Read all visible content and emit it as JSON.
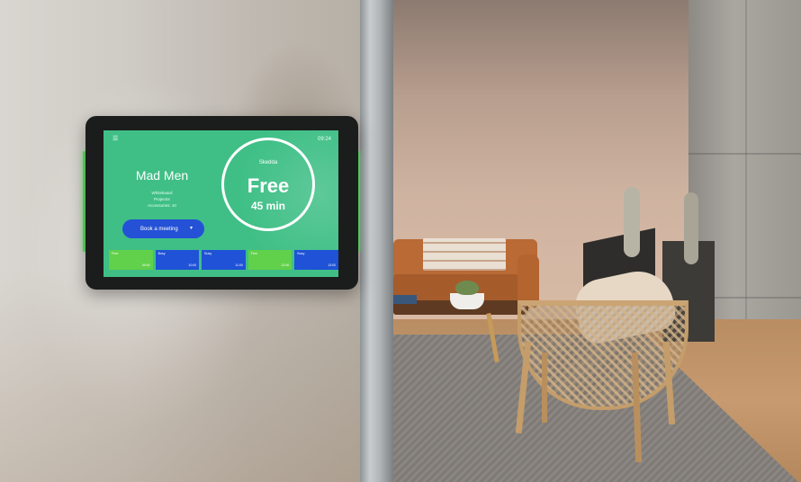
{
  "device": {
    "clock": "09:24",
    "room_name": "Mad Men",
    "amenities": [
      "Whiteboard",
      "Projector",
      "Accessories: 10"
    ],
    "book_button_label": "Book a meeting",
    "book_button_arrow": "▾",
    "brand_logo_text": "Skedda",
    "status": "Free",
    "time_remaining": "45 min",
    "timeline": [
      {
        "title": "Free",
        "time": "09:00",
        "state": "free"
      },
      {
        "title": "Busy",
        "time": "10:00",
        "state": "busy"
      },
      {
        "title": "Busy",
        "time": "11:00",
        "state": "busy"
      },
      {
        "title": "Free",
        "time": "12:00",
        "state": "free"
      },
      {
        "title": "Busy",
        "time": "13:00",
        "state": "busy"
      }
    ],
    "colors": {
      "screen_background": "#3fbf86",
      "book_button": "#2451d6",
      "slot_free": "#61d04a",
      "slot_busy": "#1f52d6",
      "led": "#63e06a"
    }
  }
}
